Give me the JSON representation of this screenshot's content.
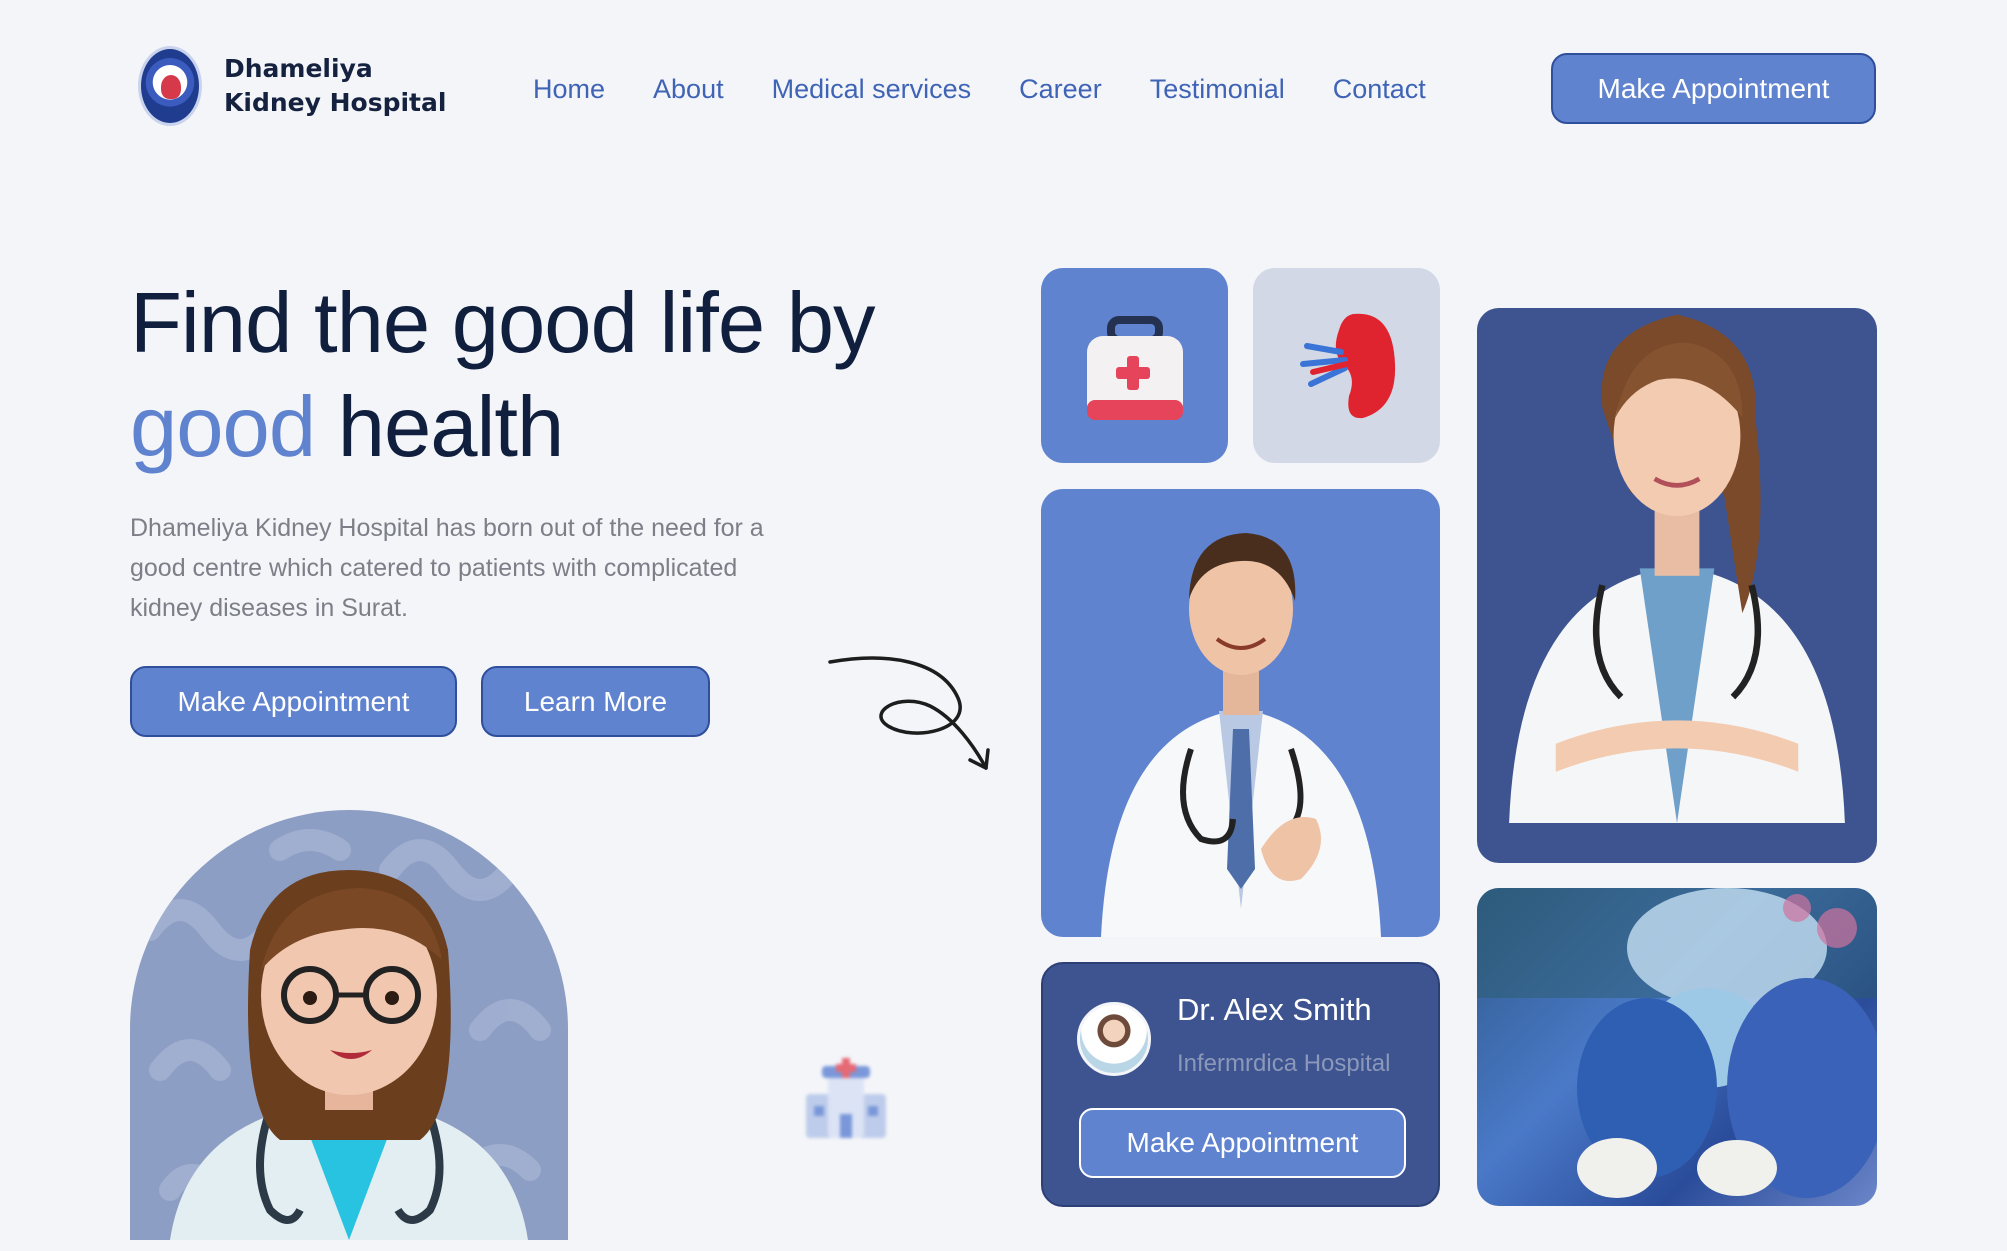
{
  "brand": {
    "line1": "Dhameliya",
    "line2": "Kidney Hospital"
  },
  "nav": {
    "items": [
      "Home",
      "About",
      "Medical services",
      "Career",
      "Testimonial",
      "Contact"
    ],
    "cta": "Make Appointment"
  },
  "hero": {
    "title_part1": "Find the good life by",
    "title_accent": "good",
    "title_part2": " health",
    "description": "Dhameliya Kidney Hospital has born out of the need for a good centre which catered to patients with complicated kidney diseases in Surat.",
    "primary_button": "Make Appointment",
    "secondary_button": "Learn More"
  },
  "doctor_card": {
    "name": "Dr. Alex Smith",
    "hospital": "Infermrdica Hospital",
    "button": "Make Appointment"
  },
  "colors": {
    "accent": "#5f83cf",
    "navy": "#3d5491",
    "text_dark": "#0f1f3d",
    "background": "#f4f5f9"
  }
}
